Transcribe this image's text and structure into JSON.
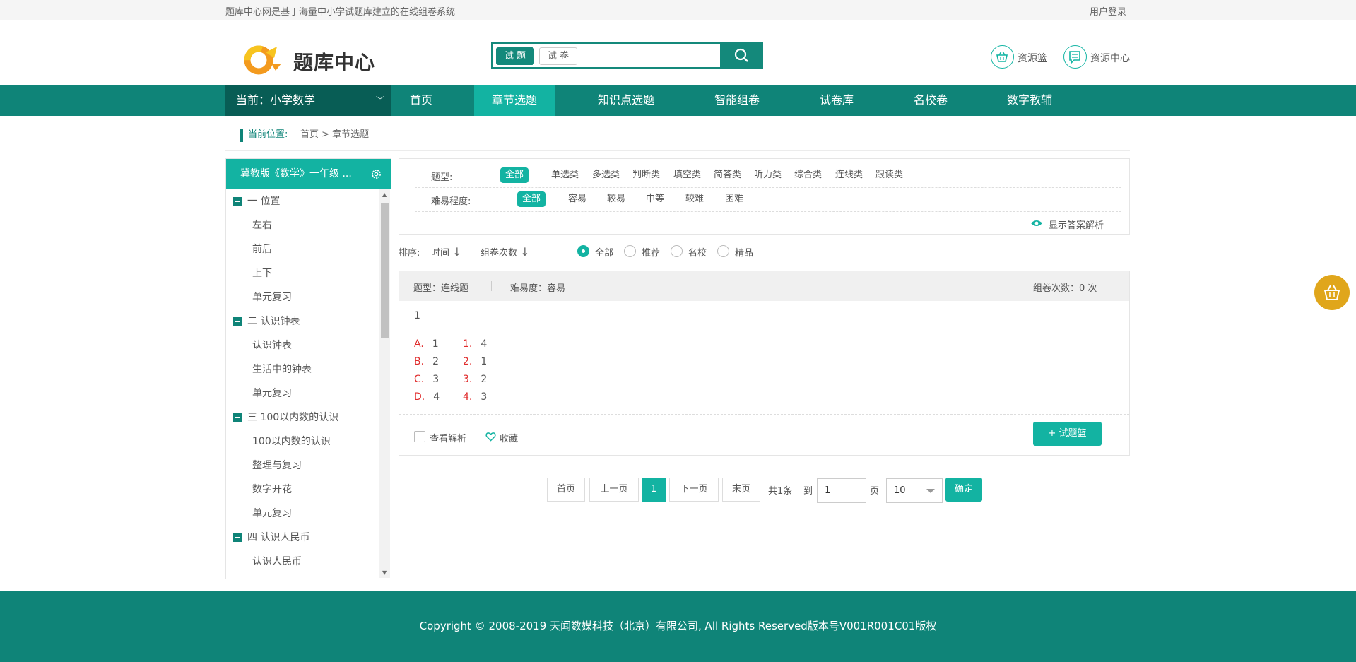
{
  "topbar": {
    "slogan": "题库中心网是基于海量中小学试题库建立的在线组卷系统",
    "login": "用户登录"
  },
  "header": {
    "logo_text": "题库中心",
    "search": {
      "tab_active": "试 题",
      "tab_other": "试 卷",
      "placeholder": ""
    },
    "links": [
      {
        "label": "资源篮",
        "icon": "basket-icon"
      },
      {
        "label": "资源中心",
        "icon": "message-icon"
      }
    ]
  },
  "nav": {
    "current": "当前：小学数学",
    "items": [
      "首页",
      "章节选题",
      "知识点选题",
      "智能组卷",
      "试卷库",
      "名校卷",
      "数字教辅"
    ],
    "active_index": 1
  },
  "breadcrumb": {
    "prefix": "当前位置:",
    "path": "首页 > 章节选题"
  },
  "sidebar": {
    "title": "冀教版《数学》一年级 ...",
    "tree": [
      {
        "label": "一 位置",
        "children": [
          "左右",
          "前后",
          "上下",
          "单元复习"
        ]
      },
      {
        "label": "二 认识钟表",
        "children": [
          "认识钟表",
          "生活中的钟表",
          "单元复习"
        ]
      },
      {
        "label": "三 100以内数的认识",
        "children": [
          "100以内数的认识",
          "整理与复习",
          "数字开花",
          "单元复习"
        ]
      },
      {
        "label": "四 认识人民币",
        "children": [
          "认识人民币"
        ]
      }
    ]
  },
  "filters": {
    "type_label": "题型:",
    "types": [
      "全部",
      "单选类",
      "多选类",
      "判断类",
      "填空类",
      "简答类",
      "听力类",
      "综合类",
      "连线类",
      "跟读类"
    ],
    "difficulty_label": "难易程度:",
    "difficulties": [
      "全部",
      "容易",
      "较易",
      "中等",
      "较难",
      "困难"
    ],
    "show_answer": "显示答案解析"
  },
  "sort": {
    "label": "排序:",
    "time": "时间",
    "count": "组卷次数",
    "radios": [
      "全部",
      "推荐",
      "名校",
      "精品"
    ],
    "radio_selected": 0
  },
  "question": {
    "type": "题型：连线题",
    "difficulty": "难易度：容易",
    "used": "组卷次数：0 次",
    "stem": "1",
    "left": [
      {
        "k": "A.",
        "v": "1"
      },
      {
        "k": "B.",
        "v": "2"
      },
      {
        "k": "C.",
        "v": "3"
      },
      {
        "k": "D.",
        "v": "4"
      }
    ],
    "right": [
      {
        "k": "1.",
        "v": "4"
      },
      {
        "k": "2.",
        "v": "1"
      },
      {
        "k": "3.",
        "v": "2"
      },
      {
        "k": "4.",
        "v": "3"
      }
    ],
    "view_analysis": "查看解析",
    "favorite": "收藏",
    "add_basket": "+ 试题篮"
  },
  "pager": {
    "first": "首页",
    "prev": "上一页",
    "current": "1",
    "next": "下一页",
    "last": "末页",
    "total": "共1条",
    "goto": "到",
    "page_unit": "页",
    "page_value": "1",
    "size": "10",
    "confirm": "确定"
  },
  "footer": {
    "copyright": "Copyright © 2008-2019 天闻数媒科技（北京）有限公司, All Rights Reserved版本号V001R001C01版权"
  },
  "colors": {
    "primary": "#0f8478",
    "accent": "#13b3a2",
    "dark": "#085d55",
    "option_key": "#e02d2d",
    "float": "#e0a61b"
  }
}
